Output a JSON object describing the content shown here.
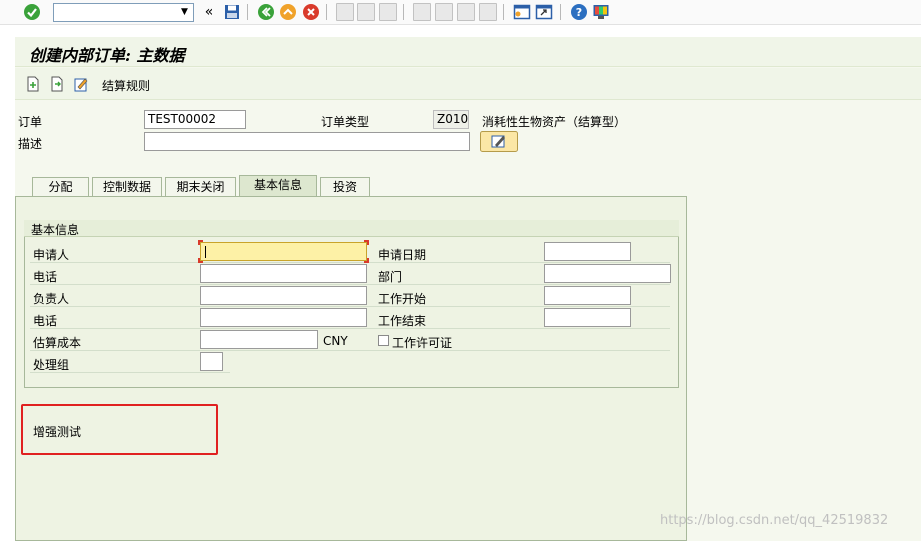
{
  "toolbar": {
    "command_field_value": "",
    "icons": [
      "enter-icon",
      "back-icon",
      "save-icon",
      "exit-icon",
      "cancel-icon",
      "print-icon",
      "find-icon",
      "find-next-icon",
      "first-page-icon",
      "previous-page-icon",
      "next-page-icon",
      "last-page-icon",
      "new-session-icon",
      "shortcut-icon",
      "help-icon",
      "customize-layout-icon"
    ]
  },
  "page": {
    "title": "创建内部订单: 主数据",
    "settlement_rule": "结算规则"
  },
  "header": {
    "order_label": "订单",
    "order_value": "TEST00002",
    "order_type_label": "订单类型",
    "order_type_value": "Z010",
    "order_type_desc": "消耗性生物资产（结算型）",
    "description_label": "描述",
    "description_value": ""
  },
  "tabs": [
    {
      "label": "分配",
      "active": false
    },
    {
      "label": "控制数据",
      "active": false
    },
    {
      "label": "期末关闭",
      "active": false
    },
    {
      "label": "基本信息",
      "active": true
    },
    {
      "label": "投资",
      "active": false
    }
  ],
  "basic_info": {
    "group_title": "基本信息",
    "applicant_label": "申请人",
    "applicant_value": "",
    "phone1_label": "电话",
    "phone1_value": "",
    "responsible_label": "负责人",
    "responsible_value": "",
    "phone2_label": "电话",
    "phone2_value": "",
    "estimated_cost_label": "估算成本",
    "estimated_cost_value": "",
    "currency": "CNY",
    "processing_group_label": "处理组",
    "processing_group_value": "",
    "application_date_label": "申请日期",
    "application_date_value": "",
    "department_label": "部门",
    "department_value": "",
    "work_start_label": "工作开始",
    "work_start_value": "",
    "work_end_label": "工作结束",
    "work_end_value": "",
    "work_permit_label": "工作许可证"
  },
  "enhancement_label": "增强测试",
  "watermark": "https://blog.csdn.net/qq_42519832",
  "colors": {
    "accent_green": "#3aa23a",
    "highlight_red": "#e02020",
    "required_field_bg": "#fdf1a6"
  }
}
